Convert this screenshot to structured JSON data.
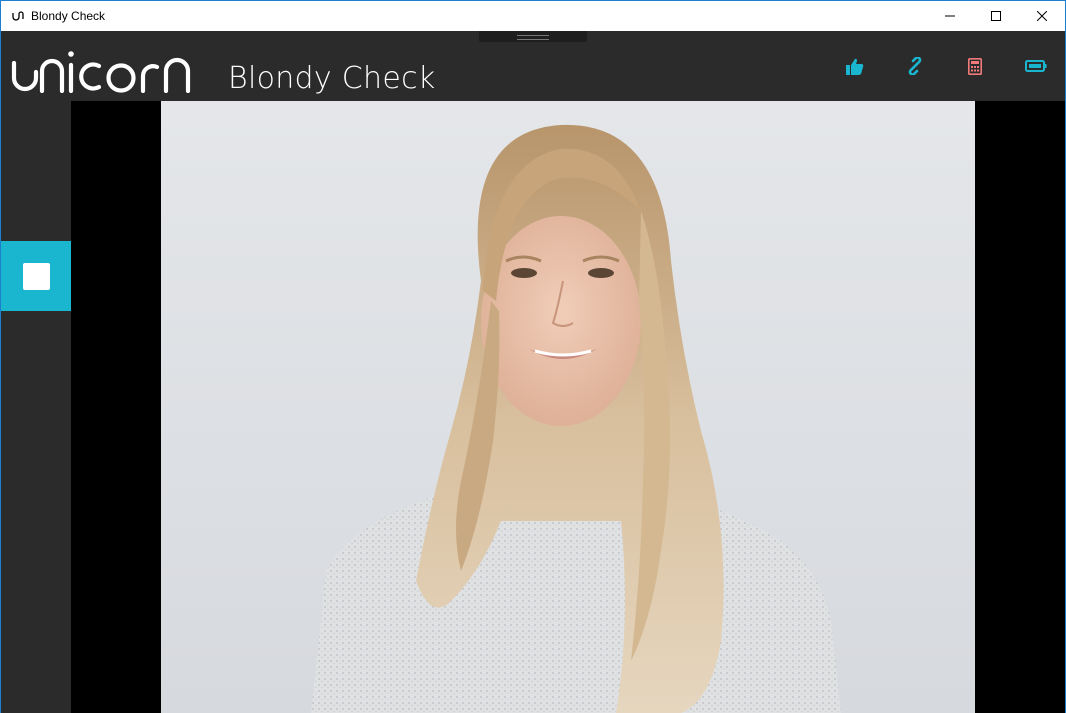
{
  "window": {
    "title": "Blondy Check",
    "controls": [
      "minimize",
      "maximize",
      "close"
    ]
  },
  "header": {
    "logo_text": "unicorn",
    "app_name": "Blondy Check",
    "buttons": [
      {
        "name": "like",
        "icon": "thumbs-up-icon",
        "color": "#1ab5cf"
      },
      {
        "name": "link",
        "icon": "link-icon",
        "color": "#1ab5cf"
      },
      {
        "name": "calculator",
        "icon": "calculator-icon",
        "color": "#f07b7b"
      },
      {
        "name": "battery",
        "icon": "battery-icon",
        "color": "#1ab5cf"
      }
    ]
  },
  "sidebar": {
    "stop_button": {
      "icon": "stop-icon",
      "color": "#1ab5cf"
    }
  },
  "viewport": {
    "content": "camera-photo"
  },
  "colors": {
    "accent": "#1ab5cf",
    "background": "#2b2b2b",
    "alert": "#f07b7b"
  }
}
